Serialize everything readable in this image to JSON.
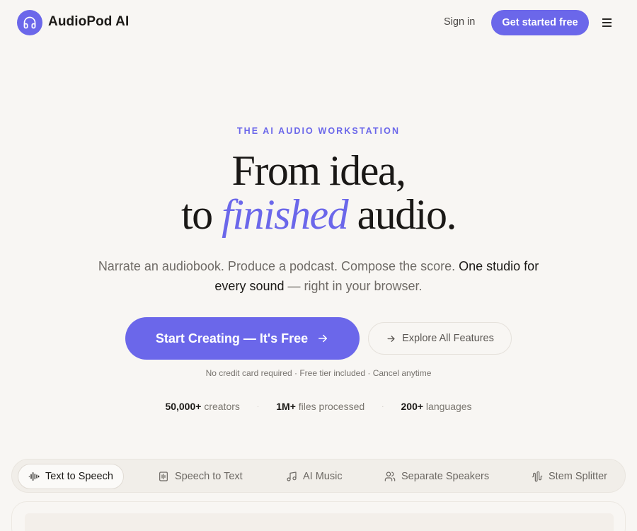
{
  "brand": {
    "name": "AudioPod AI",
    "icon": "headphones-icon",
    "accent": "#6b67ea"
  },
  "nav": {
    "signin": "Sign in",
    "cta": "Get started free",
    "menu_icon": "hamburger-menu-icon"
  },
  "hero": {
    "eyebrow": "THE AI AUDIO WORKSTATION",
    "title_line1": "From idea,",
    "title_line2_pre": "to ",
    "title_line2_accent": "finished",
    "title_line2_post": " audio.",
    "sub_1": "Narrate an audiobook. Produce a podcast. Compose the score. ",
    "sub_strong_1": "One studio for",
    "sub_strong_2": "every sound",
    "sub_2": " — right in your browser.",
    "primary_cta": "Start Creating — It's Free",
    "secondary_cta": "Explore All Features",
    "fine_print": "No credit card required · Free tier included · Cancel anytime"
  },
  "stats": [
    {
      "value": "50,000+",
      "label": " creators"
    },
    {
      "value": "1M+",
      "label": " files processed"
    },
    {
      "value": "200+",
      "label": " languages"
    }
  ],
  "stat_separator": "·",
  "tabs": [
    {
      "label": "Text to Speech",
      "icon": "waveform-icon",
      "active": true
    },
    {
      "label": "Speech to Text",
      "icon": "document-icon",
      "active": false
    },
    {
      "label": "AI Music",
      "icon": "music-note-icon",
      "active": false
    },
    {
      "label": "Separate Speakers",
      "icon": "users-icon",
      "active": false
    },
    {
      "label": "Stem Splitter",
      "icon": "audio-lines-icon",
      "active": false
    }
  ]
}
